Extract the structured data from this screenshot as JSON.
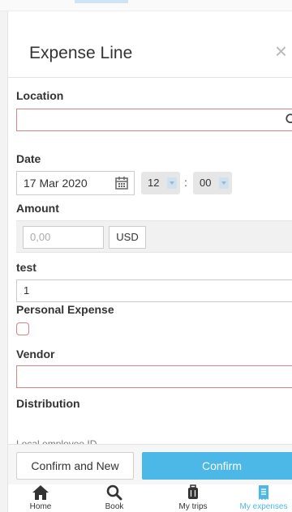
{
  "modal": {
    "title": "Expense Line",
    "close_glyph": "×"
  },
  "fields": {
    "location_label": "Location",
    "date_label": "Date",
    "date_value": "17 Mar 2020",
    "hour": "12",
    "time_separator": ":",
    "minute": "00",
    "amount_label": "Amount",
    "amount_placeholder": "0,00",
    "currency": "USD",
    "test_label": "test",
    "test_value": "1",
    "personal_expense_label": "Personal Expense",
    "personal_expense_checked": false,
    "vendor_label": "Vendor",
    "distribution_label": "Distribution",
    "local_employee_id_label": "Local employee ID"
  },
  "buttons": {
    "confirm_and_new": "Confirm and New",
    "confirm": "Confirm"
  },
  "nav": [
    {
      "label": "Home",
      "icon": "home-icon",
      "active": false
    },
    {
      "label": "Book",
      "icon": "search-icon",
      "active": false
    },
    {
      "label": "My trips",
      "icon": "luggage-icon",
      "active": false
    },
    {
      "label": "My expenses",
      "icon": "receipt-icon",
      "active": true
    }
  ],
  "colors": {
    "accent": "#4cb8e7",
    "error_border": "#d98484"
  }
}
